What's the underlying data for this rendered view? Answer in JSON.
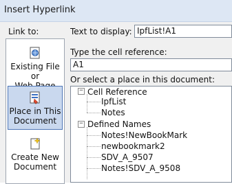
{
  "window": {
    "title": "Insert Hyperlink"
  },
  "link_to": {
    "label": "Link to:",
    "buttons": [
      {
        "line1": "Existing File or",
        "line2": "Web Page",
        "icon": "globe-file-icon"
      },
      {
        "line1": "Place in This",
        "line2": "Document",
        "icon": "document-place-icon"
      },
      {
        "line1": "Create New",
        "line2": "Document",
        "icon": "new-document-icon"
      }
    ]
  },
  "text_to_display": {
    "label": "Text to display:",
    "value": "IpfList!A1"
  },
  "cell_reference": {
    "label": "Type the cell reference:",
    "value": "A1"
  },
  "place_list": {
    "label": "Or select a place in this document:",
    "groups": [
      {
        "name": "Cell Reference",
        "toggle": "−",
        "items": [
          "IpfList",
          "Notes"
        ]
      },
      {
        "name": "Defined Names",
        "toggle": "−",
        "items": [
          "Notes!NewBookMark",
          "newbookmark2",
          "SDV_A_9507",
          "Notes!SDV_A_9508"
        ]
      }
    ]
  }
}
